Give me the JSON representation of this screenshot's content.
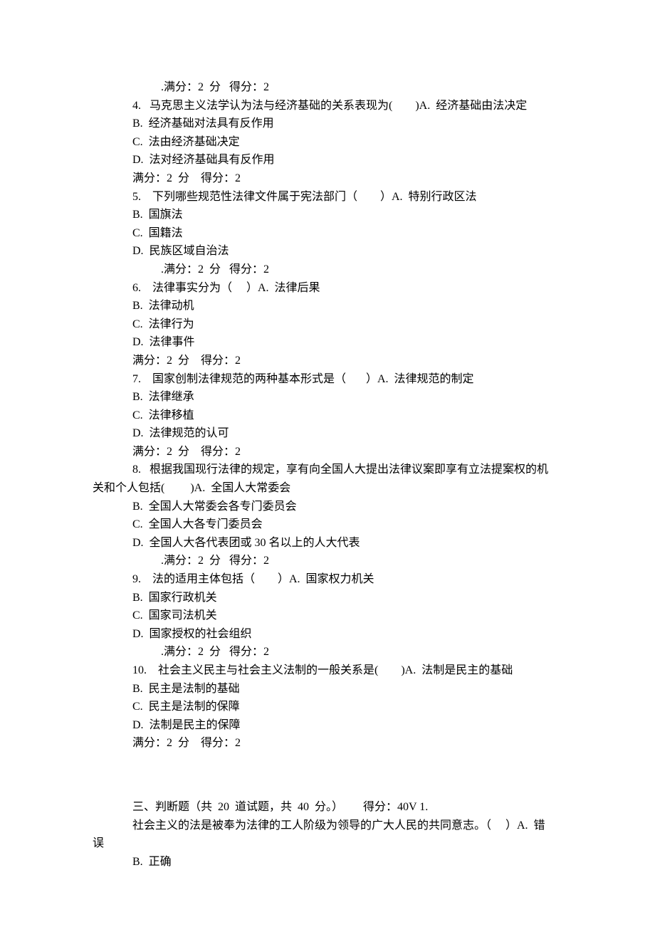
{
  "q3_score": ".满分：2  分   得分：2",
  "q4": {
    "stem": "4.   马克思主义法学认为法与经济基础的关系表现为(        )A.  经济基础由法决定",
    "b": "B.  经济基础对法具有反作用",
    "c": "C.  法由经济基础决定",
    "d": "D.  法对经济基础具有反作用",
    "score": "满分：2  分    得分：2"
  },
  "q5": {
    "stem": "5.    下列哪些规范性法律文件属于宪法部门（        ）A.  特别行政区法",
    "b": "B.  国旗法",
    "c": "C.  国籍法",
    "d": "D.  民族区域自治法",
    "score": ".满分：2  分   得分：2"
  },
  "q6": {
    "stem": "6.    法律事实分为（     ）A.  法律后果",
    "b": "B.  法律动机",
    "c": "C.  法律行为",
    "d": "D.  法律事件",
    "score": "满分：2  分    得分：2"
  },
  "q7": {
    "stem": "7.    国家创制法律规范的两种基本形式是（       ）A.  法律规范的制定",
    "b": "B.  法律继承",
    "c": "C.  法律移植",
    "d": "D.  法律规范的认可",
    "score": "满分：2  分    得分：2"
  },
  "q8": {
    "stem1": "8.   根据我国现行法律的规定，享有向全国人大提出法律议案即享有立法提案权的机",
    "stem2": "关和个人包括(         )A.  全国人大常委会",
    "b": "B.  全国人大常委会各专门委员会",
    "c": "C.  全国人大各专门委员会",
    "d": "D.  全国人大各代表团或 30 名以上的人大代表",
    "score": ".满分：2  分   得分：2"
  },
  "q9": {
    "stem": "9.    法的适用主体包括（        ）A.  国家权力机关",
    "b": "B.  国家行政机关",
    "c": "C.  国家司法机关",
    "d": "D.  国家授权的社会组织",
    "score": ".满分：2  分   得分：2"
  },
  "q10": {
    "stem": "10.    社会主义民主与社会主义法制的一般关系是(        )A.  法制是民主的基础",
    "b": "B.  民主是法制的基础",
    "c": "C.  民主是法制的保障",
    "d": "D.  法制是民主的保障",
    "score": "满分：2  分    得分：2"
  },
  "section3": {
    "header": "三、判断题（共  20  道试题，共  40  分。）       得分：40V 1.",
    "stem1": "社会主义的法是被奉为法律的工人阶级为领导的广大人民的共同意志。（     ）A.  错",
    "stem2": "误",
    "b": "B.  正确"
  }
}
